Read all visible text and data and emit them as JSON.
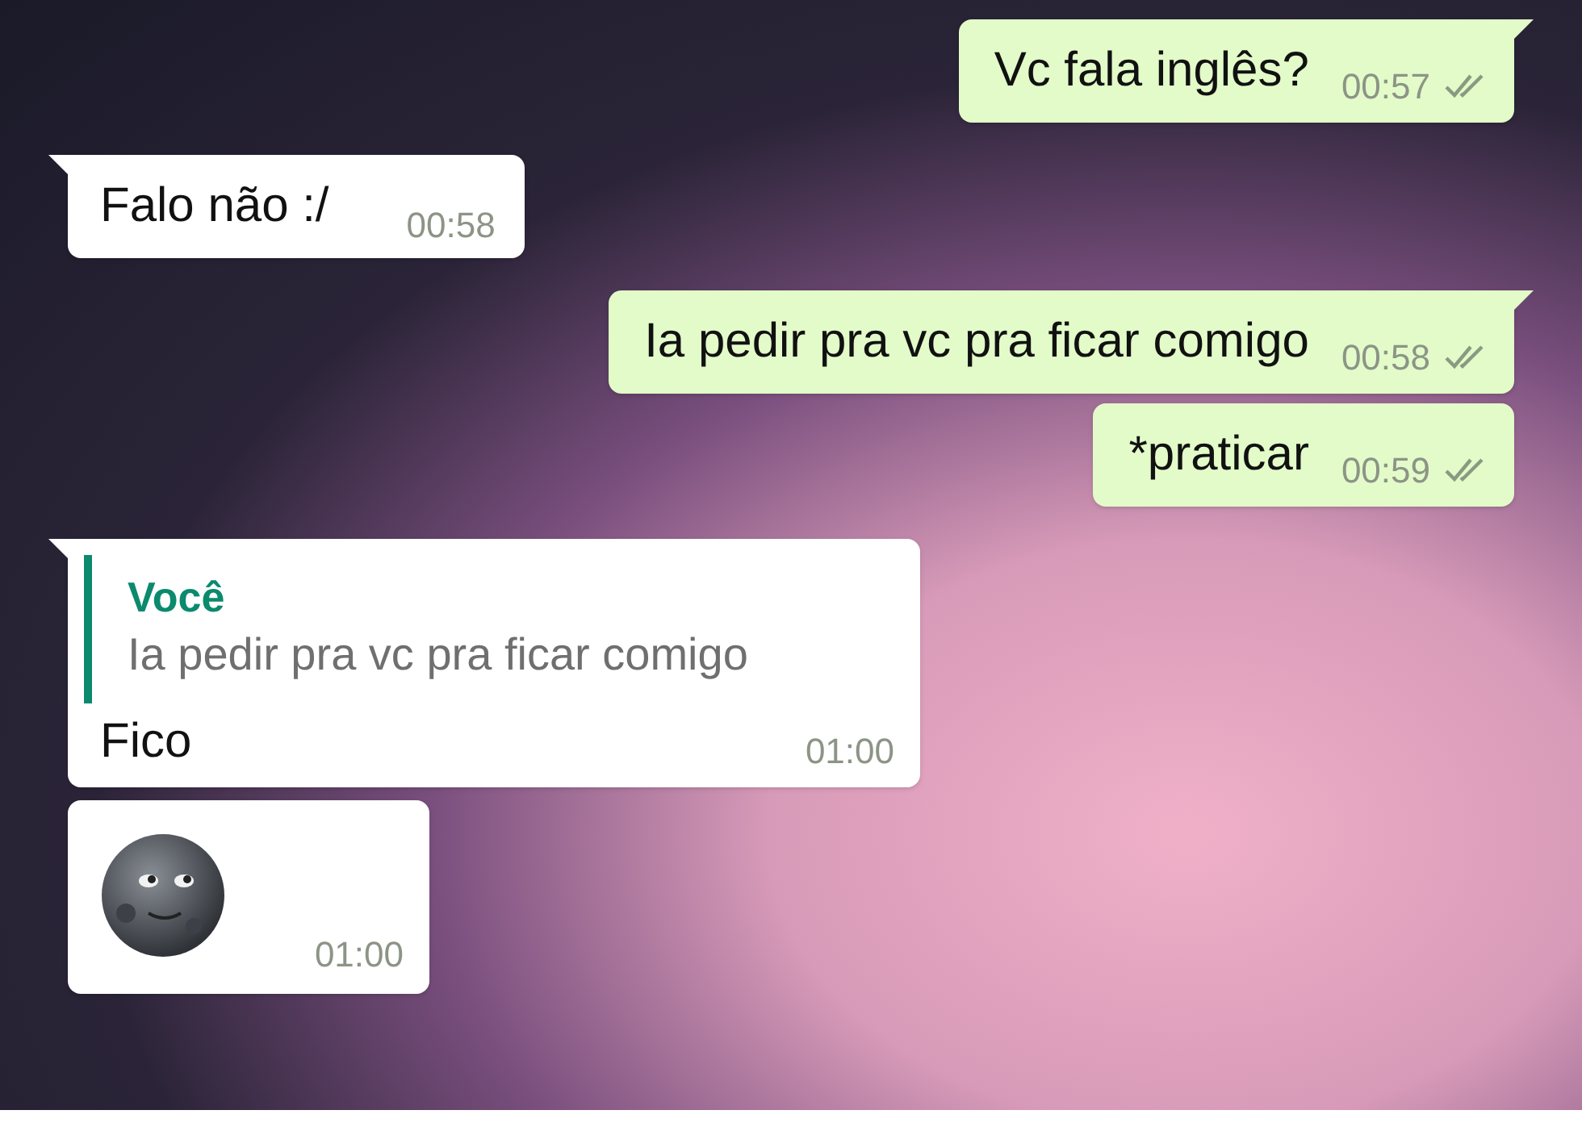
{
  "messages": [
    {
      "kind": "out",
      "tail": true,
      "text": "Vc fala inglês?",
      "time": "00:57",
      "read": false
    },
    {
      "kind": "in",
      "tail": true,
      "text": "Falo não :/",
      "time": "00:58"
    },
    {
      "kind": "out",
      "tail": true,
      "text": "Ia pedir pra vc pra ficar comigo",
      "time": "00:58",
      "read": false
    },
    {
      "kind": "out",
      "tail": false,
      "text": "*praticar",
      "time": "00:59",
      "read": false
    },
    {
      "kind": "reply",
      "tail": true,
      "quote_author": "Você",
      "quote_text": "Ia pedir pra vc pra ficar comigo",
      "text": "Fico",
      "time": "01:00"
    },
    {
      "kind": "sticker",
      "tail": false,
      "time": "01:00"
    }
  ]
}
